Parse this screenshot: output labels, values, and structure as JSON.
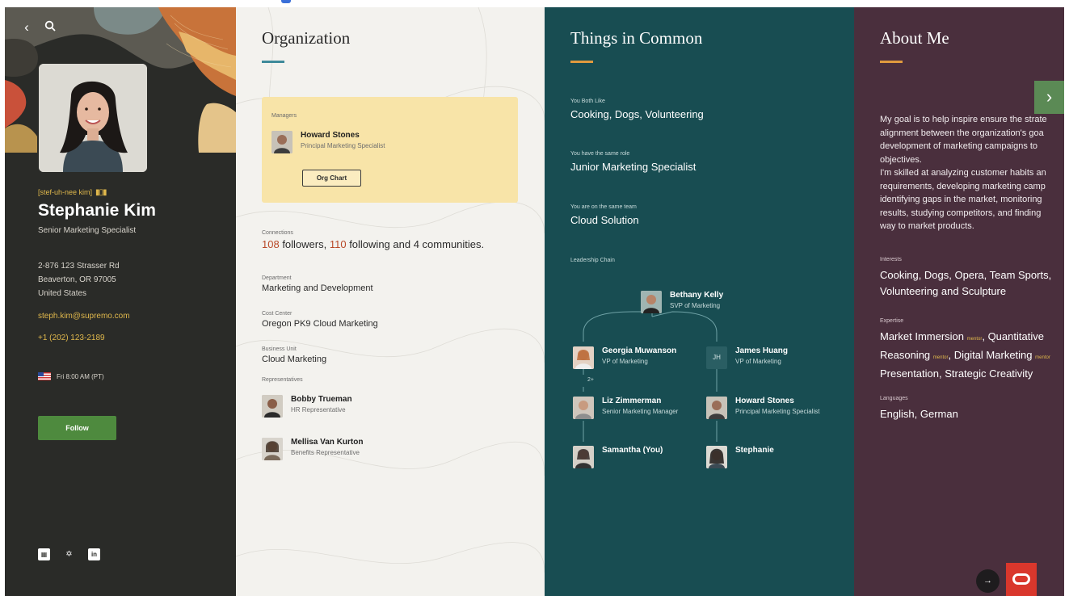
{
  "profile": {
    "pronunciation": "[stef-uh-nee kim]",
    "name": "Stephanie Kim",
    "title": "Senior Marketing Specialist",
    "address": [
      "2-876 123 Strasser Rd",
      "Beaverton, OR 97005",
      "United States"
    ],
    "email": "steph.kim@supremo.com",
    "phone": "+1 (202) 123-2189",
    "local_time": "Fri 8:00 AM (PT)",
    "follow_label": "Follow"
  },
  "organization": {
    "title": "Organization",
    "managers_label": "Managers",
    "manager": {
      "name": "Howard Stones",
      "role": "Principal Marketing Specialist"
    },
    "org_chart_label": "Org Chart",
    "connections_label": "Connections",
    "connections": {
      "followers": "108",
      "followers_text": " followers, ",
      "following": "110",
      "following_text": " following and ",
      "communities": "4",
      "communities_text": " communities."
    },
    "department_label": "Department",
    "department": "Marketing and Development",
    "cost_center_label": "Cost Center",
    "cost_center": "Oregon PK9 Cloud Marketing",
    "business_unit_label": "Business Unit",
    "business_unit": "Cloud Marketing",
    "representatives_label": "Representatives",
    "representatives": [
      {
        "name": "Bobby Trueman",
        "role": "HR Representative"
      },
      {
        "name": "Mellisa Van Kurton",
        "role": "Benefits Representative"
      }
    ]
  },
  "common": {
    "title": "Things in Common",
    "both_like_label": "You Both Like",
    "both_like": "Cooking, Dogs, Volunteering",
    "same_role_label": "You have the same role",
    "same_role": "Junior Marketing Specialist",
    "same_team_label": "You are on the same team",
    "same_team": "Cloud Solution",
    "leadership_label": "Leadership Chain",
    "chain": {
      "top": {
        "name": "Bethany Kelly",
        "role": "SVP of Marketing"
      },
      "left1": {
        "name": "Georgia Muwanson",
        "role": "VP of Marketing"
      },
      "right1": {
        "name": "James Huang",
        "role": "VP of Marketing",
        "initials": "JH"
      },
      "skip_count": "2+",
      "left2": {
        "name": "Liz Zimmerman",
        "role": "Senior Marketing Manager"
      },
      "right2": {
        "name": "Howard Stones",
        "role": "Principal Marketing Specialist"
      },
      "left3": {
        "name": "Samantha (You)"
      },
      "right3": {
        "name": "Stephanie"
      }
    }
  },
  "about": {
    "title": "About Me",
    "bio_lines": [
      "My goal is to help inspire ensure the strate",
      "alignment between the organization's goa",
      "development of marketing campaigns to",
      "objectives.",
      "I'm skilled at analyzing customer habits an",
      "requirements, developing marketing camp",
      "identifying gaps in the market, monitoring",
      "results, studying competitors, and finding",
      "way to market products."
    ],
    "interests_label": "Interests",
    "interests_lines": [
      "Cooking, Dogs, Opera, Team Sports,",
      "Volunteering and Sculpture"
    ],
    "expertise_label": "Expertise",
    "mentor_tag": "mentor",
    "expertise": {
      "e1": "Market Immersion",
      "e2": ", Quantitative",
      "e3": "Reasoning",
      "e4": ", Digital Marketing",
      "e5": "Presentation, Strategic Creativity"
    },
    "languages_label": "Languages",
    "languages": "English, German"
  },
  "icons": [
    "back-icon",
    "search-icon",
    "sound-wave-icon",
    "us-flag-icon",
    "aboutme-icon",
    "slack-icon",
    "linkedin-icon",
    "chevron-right-icon",
    "arrow-right-icon",
    "oracle-logo-icon"
  ],
  "colors": {
    "profile_bg": "#2a2b28",
    "org_bg": "#f3f2ee",
    "common_bg": "#184d52",
    "about_bg": "#4a2f3d",
    "accent_gold": "#e0b84c",
    "follow_green": "#4e8a3e",
    "manager_card": "#f8e4a8"
  }
}
